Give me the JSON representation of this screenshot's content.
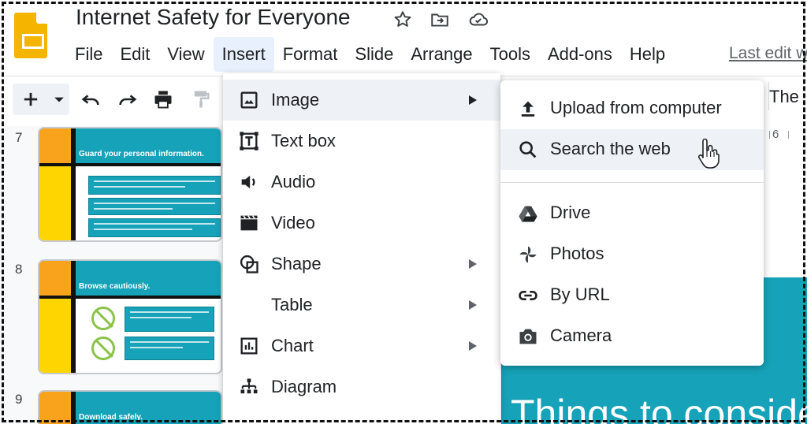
{
  "header": {
    "title": "Internet Safety for Everyone",
    "icons": [
      "star-icon",
      "move-to-folder-icon",
      "cloud-saved-icon"
    ]
  },
  "menubar": {
    "items": [
      "File",
      "Edit",
      "View",
      "Insert",
      "Format",
      "Slide",
      "Arrange",
      "Tools",
      "Add-ons",
      "Help"
    ],
    "active": "Insert",
    "last_edit": "Last edit w"
  },
  "toolbar": {
    "icons": [
      "plus-icon",
      "dropdown-arrow-icon",
      "undo-icon",
      "redo-icon",
      "print-icon",
      "paint-format-icon"
    ],
    "theme_label": "The"
  },
  "filmstrip": {
    "slides": [
      {
        "number": "7",
        "title": "Guard your personal information."
      },
      {
        "number": "8",
        "title": "Browse cautiously."
      },
      {
        "number": "9",
        "title": "Download safely."
      }
    ]
  },
  "ruler": {
    "visible_number": "6"
  },
  "canvas": {
    "slide_heading": "Things to conside"
  },
  "insert_menu": {
    "items": [
      {
        "label": "Image",
        "icon": "image-icon",
        "has_submenu": true,
        "highlighted": true
      },
      {
        "label": "Text box",
        "icon": "text-box-icon",
        "has_submenu": false
      },
      {
        "label": "Audio",
        "icon": "audio-icon",
        "has_submenu": false
      },
      {
        "label": "Video",
        "icon": "video-icon",
        "has_submenu": false
      },
      {
        "label": "Shape",
        "icon": "shape-icon",
        "has_submenu": true
      },
      {
        "label": "Table",
        "icon": "",
        "has_submenu": true
      },
      {
        "label": "Chart",
        "icon": "chart-icon",
        "has_submenu": true
      },
      {
        "label": "Diagram",
        "icon": "diagram-icon",
        "has_submenu": false
      }
    ]
  },
  "image_submenu": {
    "items": [
      {
        "label": "Upload from computer",
        "icon": "upload-icon"
      },
      {
        "label": "Search the web",
        "icon": "search-icon",
        "highlighted": true
      },
      {
        "label": "Drive",
        "icon": "drive-icon"
      },
      {
        "label": "Photos",
        "icon": "photos-icon"
      },
      {
        "label": "By URL",
        "icon": "link-icon"
      },
      {
        "label": "Camera",
        "icon": "camera-icon"
      }
    ]
  },
  "colors": {
    "accent_teal": "#16a2b8",
    "accent_orange": "#f9a21b",
    "accent_yellow": "#ffd500",
    "menu_highlight": "#eef1f5",
    "logo_yellow": "#f4b400"
  }
}
